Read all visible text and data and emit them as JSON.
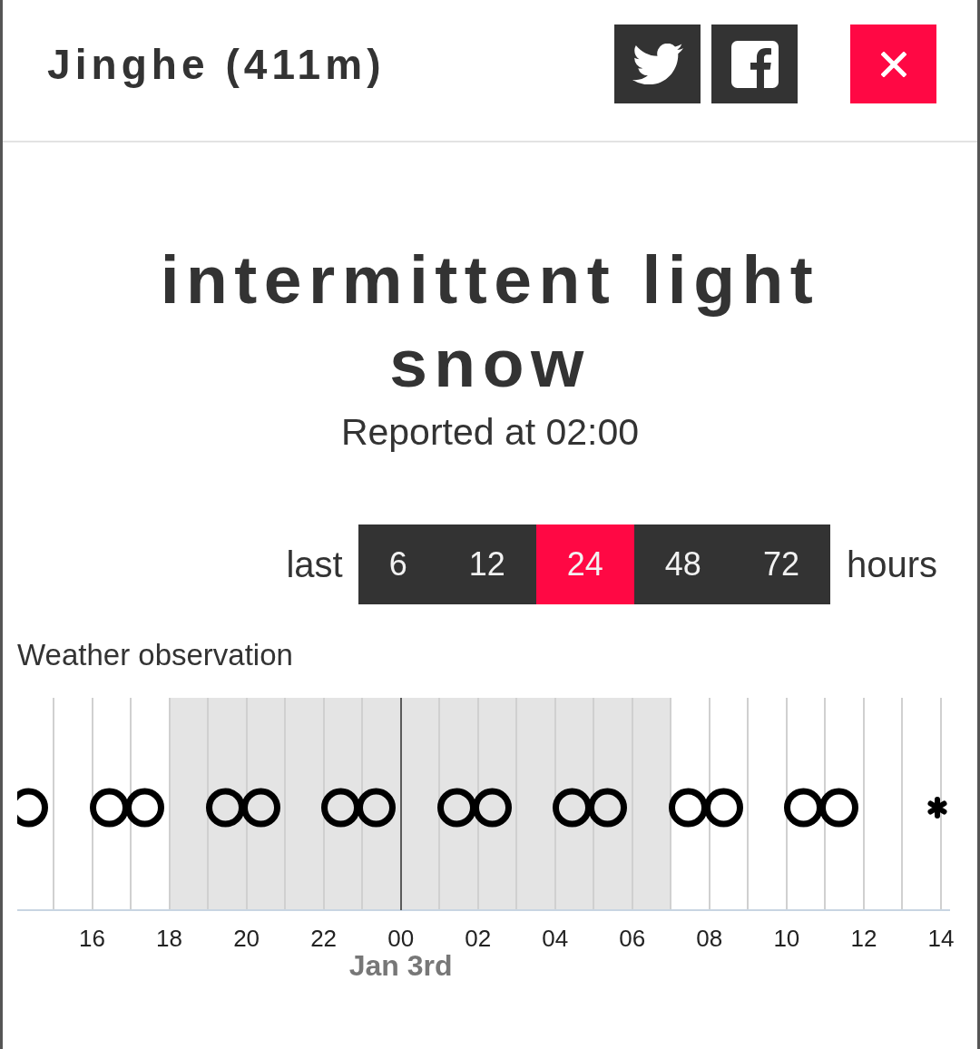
{
  "header": {
    "title": "Jinghe (411m)"
  },
  "condition": {
    "headline": "intermittent light snow",
    "reported": "Reported at 02:00"
  },
  "range": {
    "prefix": "last",
    "options": [
      {
        "label": "6",
        "selected": false
      },
      {
        "label": "12",
        "selected": false
      },
      {
        "label": "24",
        "selected": true
      },
      {
        "label": "48",
        "selected": false
      },
      {
        "label": "72",
        "selected": false
      }
    ],
    "suffix": "hours"
  },
  "observation": {
    "title": "Weather observation",
    "columns": [
      {
        "shaded": false
      },
      {
        "shaded": false
      },
      {
        "shaded": false
      },
      {
        "shaded": true
      },
      {
        "shaded": true
      },
      {
        "shaded": true
      },
      {
        "shaded": true
      },
      {
        "shaded": true
      },
      {
        "shaded": true
      },
      {
        "shaded": true
      },
      {
        "shaded": true
      },
      {
        "shaded": true
      },
      {
        "shaded": true
      },
      {
        "shaded": true
      },
      {
        "shaded": true
      },
      {
        "shaded": true
      },
      {
        "shaded": false
      },
      {
        "shaded": false
      },
      {
        "shaded": false
      },
      {
        "shaded": false
      },
      {
        "shaded": false
      },
      {
        "shaded": false
      },
      {
        "shaded": false
      }
    ],
    "symbols": [
      {
        "kind": "rings"
      },
      {
        "kind": "rings"
      },
      {
        "kind": "rings"
      },
      {
        "kind": "rings"
      },
      {
        "kind": "rings"
      },
      {
        "kind": "rings"
      },
      {
        "kind": "rings"
      },
      {
        "kind": "rings"
      },
      {
        "kind": "asterisk"
      }
    ],
    "ticks": [
      {
        "label": "16"
      },
      {
        "label": "18"
      },
      {
        "label": "20"
      },
      {
        "label": "22"
      },
      {
        "label": "00",
        "date": "Jan 3rd"
      },
      {
        "label": "02"
      },
      {
        "label": "04"
      },
      {
        "label": "06"
      },
      {
        "label": "08"
      },
      {
        "label": "10"
      },
      {
        "label": "12"
      },
      {
        "label": "14"
      }
    ]
  }
}
